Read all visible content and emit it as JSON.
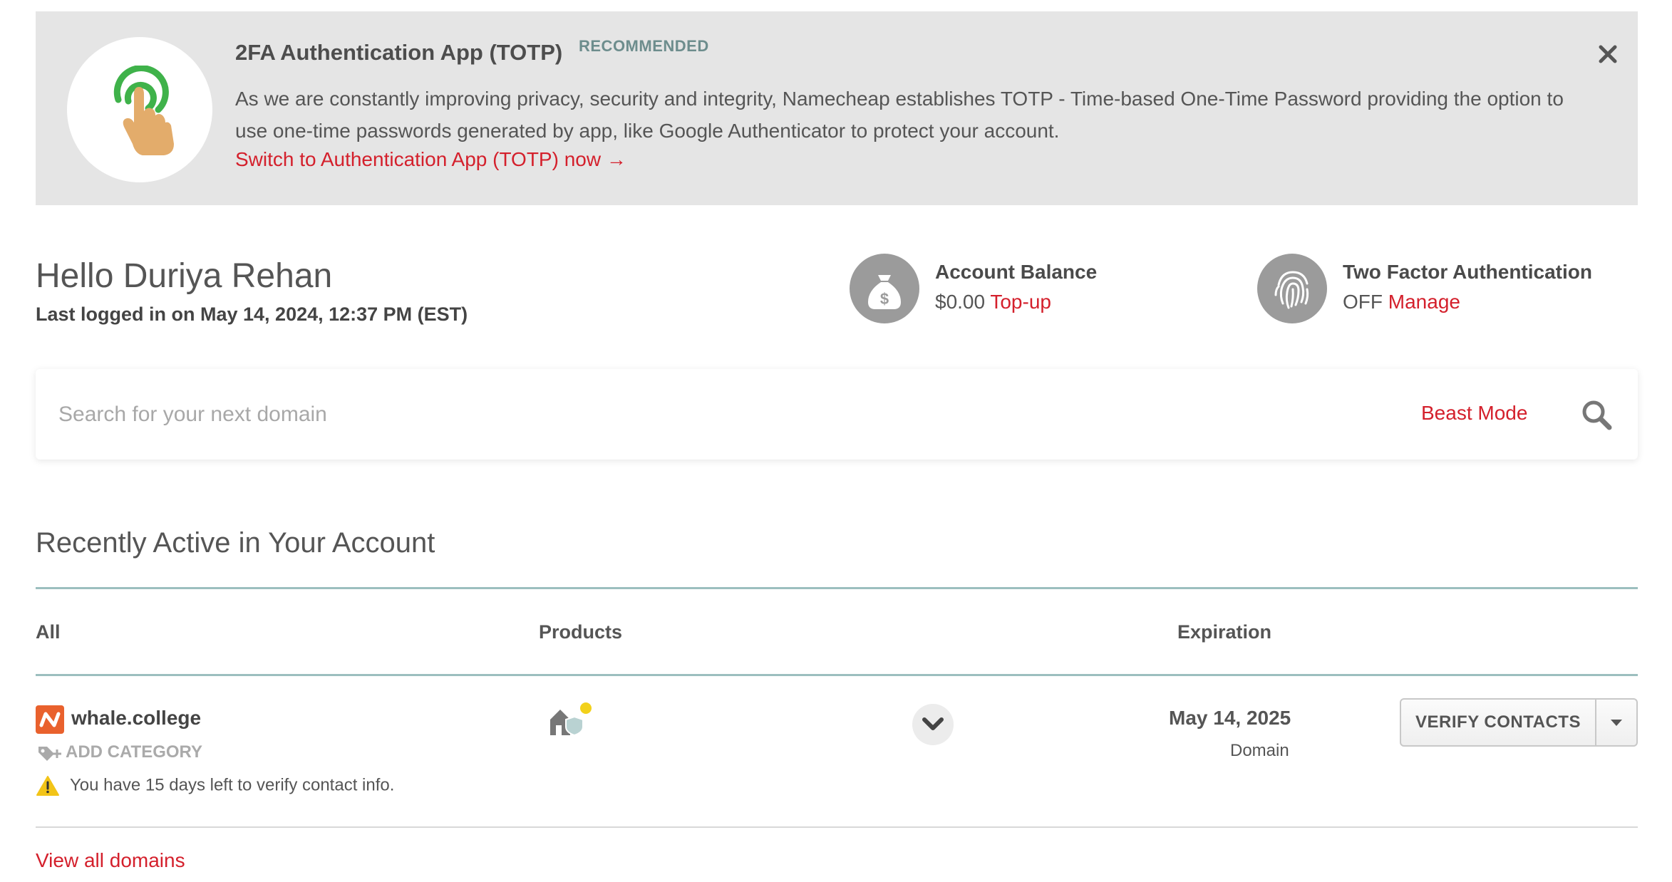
{
  "banner": {
    "title": "2FA Authentication App (TOTP)",
    "badge": "RECOMMENDED",
    "text": "As we are constantly improving privacy, security and integrity, Namecheap establishes TOTP - Time-based One-Time Password providing the option to use one-time passwords generated by app, like Google Authenticator to protect your account.",
    "link": "Switch to Authentication App (TOTP) now →",
    "icon": "finger-tap-icon",
    "close_icon": "close-icon"
  },
  "greeting": {
    "hello": "Hello Duriya Rehan",
    "last_login": "Last logged in on May 14, 2024, 12:37 PM (EST)"
  },
  "account_balance": {
    "label": "Account Balance",
    "value": "$0.00",
    "link": "Top-up",
    "icon": "money-bag-icon"
  },
  "two_factor": {
    "label": "Two Factor Authentication",
    "status": "OFF",
    "link": "Manage",
    "icon": "fingerprint-icon"
  },
  "search": {
    "placeholder": "Search for your next domain",
    "beast_mode": "Beast Mode",
    "icon": "search-icon"
  },
  "recent": {
    "title": "Recently Active in Your Account",
    "columns": {
      "all": "All",
      "products": "Products",
      "expiration": "Expiration"
    },
    "rows": [
      {
        "domain": "whale.college",
        "add_category": "ADD CATEGORY",
        "warning": "You have 15 days left to verify contact info.",
        "expiration_date": "May 14, 2025",
        "expiration_type": "Domain",
        "action": "VERIFY CONTACTS"
      }
    ],
    "view_all": "View all domains"
  },
  "colors": {
    "accent": "#d4202c",
    "banner_bg": "#e5e5e5",
    "teal_rule": "#9cbfbf",
    "badge": "#6d8d8d",
    "logo_orange": "#e9612d"
  }
}
